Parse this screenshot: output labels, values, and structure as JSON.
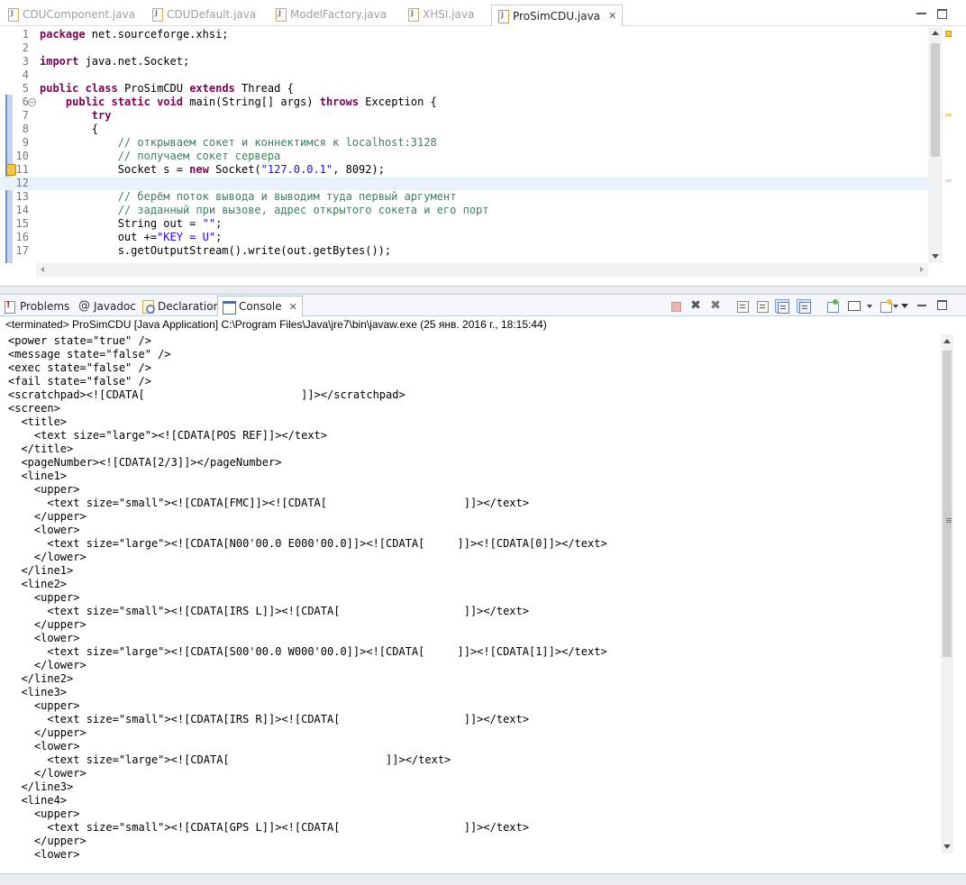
{
  "editor": {
    "tabs": [
      {
        "label": "CDUComponent.java",
        "active": false
      },
      {
        "label": "CDUDefault.java",
        "active": false
      },
      {
        "label": "ModelFactory.java",
        "active": false
      },
      {
        "label": "XHSI.java",
        "active": false
      },
      {
        "label": "ProSimCDU.java",
        "active": true
      }
    ],
    "close_glyph": "✕",
    "lines": [
      {
        "n": "1",
        "code": "package net.sourceforge.xhsi;"
      },
      {
        "n": "2",
        "code": ""
      },
      {
        "n": "3",
        "code": "import java.net.Socket;"
      },
      {
        "n": "4",
        "code": ""
      },
      {
        "n": "5",
        "code": "public class ProSimCDU extends Thread {"
      },
      {
        "n": "6",
        "code": "    public static void main(String[] args) throws Exception {"
      },
      {
        "n": "7",
        "code": "        try"
      },
      {
        "n": "8",
        "code": "        {"
      },
      {
        "n": "9",
        "code": "            // открываем сокет и коннектимся к localhost:3128"
      },
      {
        "n": "10",
        "code": "            // получаем сокет сервера"
      },
      {
        "n": "11",
        "code": "            Socket s = new Socket(\"127.0.0.1\", 8092);"
      },
      {
        "n": "12",
        "code": ""
      },
      {
        "n": "13",
        "code": "            // берём поток вывода и выводим туда первый аргумент"
      },
      {
        "n": "14",
        "code": "            // заданный при вызове, адрес открытого сокета и его порт"
      },
      {
        "n": "15",
        "code": "            String out = \"\";"
      },
      {
        "n": "16",
        "code": "            out +=\"KEY = U\";"
      },
      {
        "n": "17",
        "code": "            s.getOutputStream().write(out.getBytes());"
      }
    ]
  },
  "views": {
    "tabs": [
      {
        "label": "Problems",
        "icon": "problems-icon"
      },
      {
        "label": "Javadoc",
        "icon": "javadoc-icon"
      },
      {
        "label": "Declaration",
        "icon": "declaration-icon"
      },
      {
        "label": "Console",
        "icon": "console-icon",
        "active": true
      }
    ],
    "javadoc_glyph": "@",
    "close_glyph": "✕"
  },
  "console": {
    "launch_info": "<terminated> ProSimCDU [Java Application] C:\\Program Files\\Java\\jre7\\bin\\javaw.exe (25 янв. 2016 г., 18:15:44)",
    "toolbar": {
      "remove_glyph": "✖",
      "remove_all_glyph": "✖"
    },
    "lines": [
      "<power state=\"true\" />",
      "<message state=\"false\" />",
      "<exec state=\"false\" />",
      "<fail state=\"false\" />",
      "<scratchpad><![CDATA[                        ]]></scratchpad>",
      "<screen>",
      "  <title>",
      "    <text size=\"large\"><![CDATA[POS REF]]></text>",
      "  </title>",
      "  <pageNumber><![CDATA[2/3]]></pageNumber>",
      "  <line1>",
      "    <upper>",
      "      <text size=\"small\"><![CDATA[FMC]]><![CDATA[                     ]]></text>",
      "    </upper>",
      "    <lower>",
      "      <text size=\"large\"><![CDATA[N00'00.0 E000'00.0]]><![CDATA[     ]]><![CDATA[0]]></text>",
      "    </lower>",
      "  </line1>",
      "  <line2>",
      "    <upper>",
      "      <text size=\"small\"><![CDATA[IRS L]]><![CDATA[                   ]]></text>",
      "    </upper>",
      "    <lower>",
      "      <text size=\"large\"><![CDATA[S00'00.0 W000'00.0]]><![CDATA[     ]]><![CDATA[1]]></text>",
      "    </lower>",
      "  </line2>",
      "  <line3>",
      "    <upper>",
      "      <text size=\"small\"><![CDATA[IRS R]]><![CDATA[                   ]]></text>",
      "    </upper>",
      "    <lower>",
      "      <text size=\"large\"><![CDATA[                        ]]></text>",
      "    </lower>",
      "  </line3>",
      "  <line4>",
      "    <upper>",
      "      <text size=\"small\"><![CDATA[GPS L]]><![CDATA[                   ]]></text>",
      "    </upper>",
      "    <lower>"
    ]
  },
  "colors": {
    "keyword": "#7f0055",
    "comment": "#3f7f5f",
    "string": "#2a00ff",
    "current_line": "#e8f2fe"
  }
}
